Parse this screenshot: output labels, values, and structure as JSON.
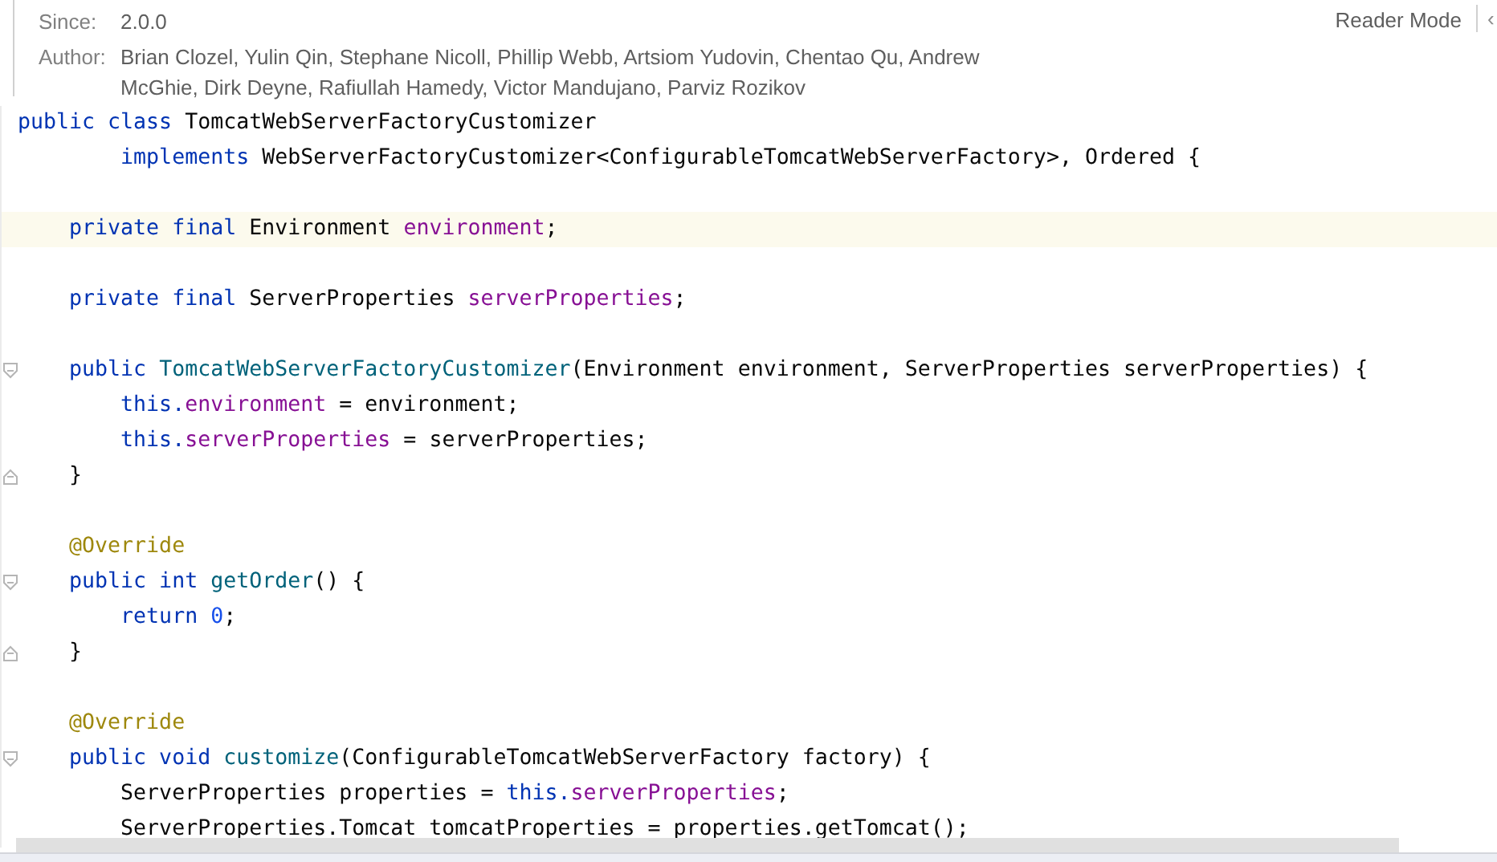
{
  "doc": {
    "since_label": "Since:",
    "since": "2.0.0",
    "author_label": "Author:",
    "author": "Brian Clozel, Yulin Qin, Stephane Nicoll, Phillip Webb, Artsiom Yudovin, Chentao Qu, Andrew McGhie, Dirk Deyne, Rafiullah Hamedy, Victor Mandujano, Parviz Rozikov",
    "reader_mode": "Reader Mode",
    "collapse_glyph": "‹"
  },
  "lines": [
    {
      "kind": "code",
      "current": false,
      "fold_start": false,
      "fold_end": false,
      "tokens": [
        {
          "t": "public class ",
          "kind": "keyword"
        },
        {
          "t": "TomcatWebServerFactoryCustomizer",
          "kind": "plain"
        }
      ]
    },
    {
      "kind": "code",
      "current": false,
      "fold_start": false,
      "fold_end": false,
      "tokens": [
        {
          "t": "        implements ",
          "kind": "keyword"
        },
        {
          "t": "WebServerFactoryCustomizer<ConfigurableTomcatWebServerFactory>, Ordered {",
          "kind": "plain"
        }
      ]
    },
    {
      "kind": "blank"
    },
    {
      "kind": "code",
      "current": true,
      "fold_start": false,
      "fold_end": false,
      "tokens": [
        {
          "t": "    private final ",
          "kind": "keyword"
        },
        {
          "t": "Environment ",
          "kind": "plain"
        },
        {
          "t": "environment",
          "kind": "field"
        },
        {
          "t": ";",
          "kind": "plain"
        }
      ]
    },
    {
      "kind": "blank"
    },
    {
      "kind": "code",
      "current": false,
      "fold_start": false,
      "fold_end": false,
      "tokens": [
        {
          "t": "    private final ",
          "kind": "keyword"
        },
        {
          "t": "ServerProperties ",
          "kind": "plain"
        },
        {
          "t": "serverProperties",
          "kind": "field"
        },
        {
          "t": ";",
          "kind": "plain"
        }
      ]
    },
    {
      "kind": "blank"
    },
    {
      "kind": "code",
      "current": false,
      "fold_start": true,
      "fold_end": false,
      "tokens": [
        {
          "t": "    public ",
          "kind": "keyword"
        },
        {
          "t": "TomcatWebServerFactoryCustomizer",
          "kind": "method"
        },
        {
          "t": "(Environment environment, ServerProperties serverProperties) {",
          "kind": "plain"
        }
      ]
    },
    {
      "kind": "code",
      "current": false,
      "fold_start": false,
      "fold_end": false,
      "tokens": [
        {
          "t": "        this.",
          "kind": "keyword"
        },
        {
          "t": "environment",
          "kind": "field"
        },
        {
          "t": " = environment;",
          "kind": "plain"
        }
      ]
    },
    {
      "kind": "code",
      "current": false,
      "fold_start": false,
      "fold_end": false,
      "tokens": [
        {
          "t": "        this.",
          "kind": "keyword"
        },
        {
          "t": "serverProperties",
          "kind": "field"
        },
        {
          "t": " = serverProperties;",
          "kind": "plain"
        }
      ]
    },
    {
      "kind": "code",
      "current": false,
      "fold_start": false,
      "fold_end": true,
      "tokens": [
        {
          "t": "    }",
          "kind": "plain"
        }
      ]
    },
    {
      "kind": "blank"
    },
    {
      "kind": "code",
      "current": false,
      "fold_start": false,
      "fold_end": false,
      "tokens": [
        {
          "t": "    @Override",
          "kind": "annotation"
        }
      ]
    },
    {
      "kind": "code",
      "current": false,
      "fold_start": true,
      "fold_end": false,
      "tokens": [
        {
          "t": "    public int ",
          "kind": "keyword"
        },
        {
          "t": "getOrder",
          "kind": "method"
        },
        {
          "t": "() {",
          "kind": "plain"
        }
      ]
    },
    {
      "kind": "code",
      "current": false,
      "fold_start": false,
      "fold_end": false,
      "tokens": [
        {
          "t": "        return ",
          "kind": "keyword"
        },
        {
          "t": "0",
          "kind": "number"
        },
        {
          "t": ";",
          "kind": "plain"
        }
      ]
    },
    {
      "kind": "code",
      "current": false,
      "fold_start": false,
      "fold_end": true,
      "tokens": [
        {
          "t": "    }",
          "kind": "plain"
        }
      ]
    },
    {
      "kind": "blank"
    },
    {
      "kind": "code",
      "current": false,
      "fold_start": false,
      "fold_end": false,
      "tokens": [
        {
          "t": "    @Override",
          "kind": "annotation"
        }
      ]
    },
    {
      "kind": "code",
      "current": false,
      "fold_start": true,
      "fold_end": false,
      "tokens": [
        {
          "t": "    public void ",
          "kind": "keyword"
        },
        {
          "t": "customize",
          "kind": "method"
        },
        {
          "t": "(ConfigurableTomcatWebServerFactory factory) {",
          "kind": "plain"
        }
      ]
    },
    {
      "kind": "code",
      "current": false,
      "fold_start": false,
      "fold_end": false,
      "tokens": [
        {
          "t": "        ServerProperties properties = ",
          "kind": "plain"
        },
        {
          "t": "this.",
          "kind": "keyword"
        },
        {
          "t": "serverProperties",
          "kind": "field"
        },
        {
          "t": ";",
          "kind": "plain"
        }
      ]
    },
    {
      "kind": "code",
      "current": false,
      "fold_start": false,
      "fold_end": false,
      "tokens": [
        {
          "t": "        ServerProperties.Tomcat tomcatProperties = properties.getTomcat();",
          "kind": "plain"
        }
      ]
    }
  ]
}
